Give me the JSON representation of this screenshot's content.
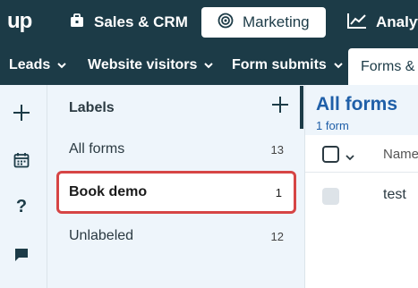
{
  "topbar": {
    "logo": "up",
    "tabs": [
      {
        "label": "Sales & CRM",
        "icon": "briefcase-icon"
      },
      {
        "label": "Marketing",
        "icon": "target-icon",
        "active": true
      },
      {
        "label": "Analyt",
        "icon": "line-chart-icon"
      }
    ]
  },
  "subnav": {
    "tabs": [
      {
        "label": "Leads"
      },
      {
        "label": "Website visitors"
      },
      {
        "label": "Form submits"
      },
      {
        "label": "Forms &",
        "active": true
      }
    ]
  },
  "rail": {
    "icons": [
      "plus-icon",
      "calendar-icon",
      "help-icon",
      "chat-icon"
    ],
    "help_glyph": "?"
  },
  "labels": {
    "title": "Labels",
    "items": [
      {
        "name": "All forms",
        "count": "13"
      },
      {
        "name": "Book demo",
        "count": "1",
        "selected": true
      },
      {
        "name": "Unlabeled",
        "count": "12"
      }
    ]
  },
  "main": {
    "title": "All forms",
    "count_text": "1 form",
    "columns": [
      "Name"
    ],
    "rows": [
      {
        "name": "test"
      }
    ]
  },
  "colors": {
    "nav_bg": "#1c3b47",
    "panel_bg": "#eef5fb",
    "accent_blue": "#1f5fa8",
    "highlight_red": "#d64545"
  }
}
